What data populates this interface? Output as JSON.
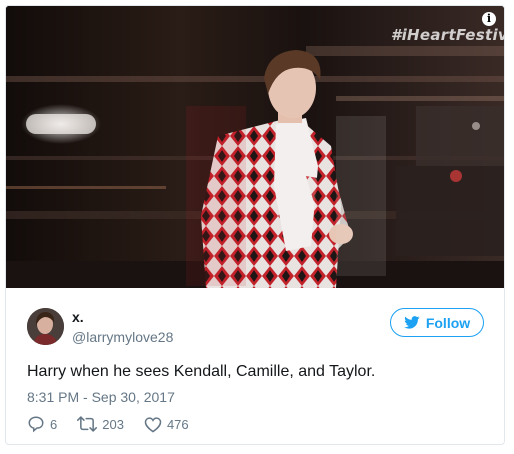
{
  "media": {
    "watermark": "#iHeartFestiv",
    "info_icon": "info-icon"
  },
  "tweet": {
    "display_name": "x.",
    "handle": "@larrymylove28",
    "follow_label": "Follow",
    "text": "Harry when he sees Kendall, Camille, and Taylor.",
    "timestamp": "8:31 PM - Sep 30, 2017",
    "reply_count": "6",
    "retweet_count": "203",
    "like_count": "476"
  },
  "colors": {
    "twitter_blue": "#1da1f2",
    "secondary_text": "#657786",
    "primary_text": "#14171a",
    "border": "#e1e8ed"
  }
}
